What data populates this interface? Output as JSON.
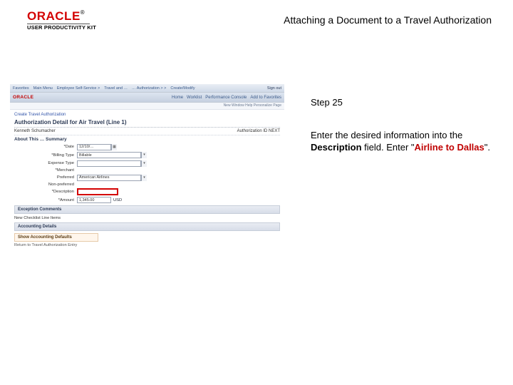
{
  "header": {
    "logo_text": "ORACLE",
    "logo_sub": "USER PRODUCTIVITY KIT",
    "page_title": "Attaching a Document to a Travel Authorization"
  },
  "mock": {
    "nav_items": [
      "Favorites",
      "Main Menu",
      "Employee Self-Service >",
      "Travel and …",
      "… Authorization > >",
      "Create/Modify"
    ],
    "nav_right": "Sign out",
    "brand": "ORACLE",
    "brand_items": [
      "Home",
      "Worklist",
      "Performance Console",
      "Add to Favorites"
    ],
    "subbar": "New Window   Help   Personalize Page",
    "breadcrumb": "Create Travel Authorization",
    "heading": "Authorization Detail for Air Travel (Line 1)",
    "meta_left": "Kenneth Schumacher",
    "meta_right": "Authorization ID  NEXT",
    "sub": "About This … Summary",
    "rows": {
      "date_label": "*Date",
      "date_value": "12/10/…",
      "billing_label": "*Billing Type",
      "billing_value": "Billable",
      "expense_label": "Expense Type",
      "expense_value": "",
      "merchant_label": "*Merchant",
      "pref_label": "Preferred",
      "pref_value": "American Airlines",
      "nonpref_label": "Non-preferred",
      "desc_label": "*Description",
      "desc_value": "",
      "amount_label": "*Amount",
      "amount_value": "1,345.00",
      "amount_cur": "USD"
    },
    "sections": {
      "comments": "Exception Comments",
      "checklist": "New Checklist Line Items",
      "accounting": "Accounting Details",
      "accounting_btn": "Show Accounting Defaults"
    },
    "note": "Return to Travel Authorization Entry"
  },
  "right": {
    "step": "Step 25",
    "intro": "Enter the desired information into the ",
    "field_name": "Description",
    "mid": " field. Enter \"",
    "value": "Airline to Dallas",
    "end": "\"."
  }
}
